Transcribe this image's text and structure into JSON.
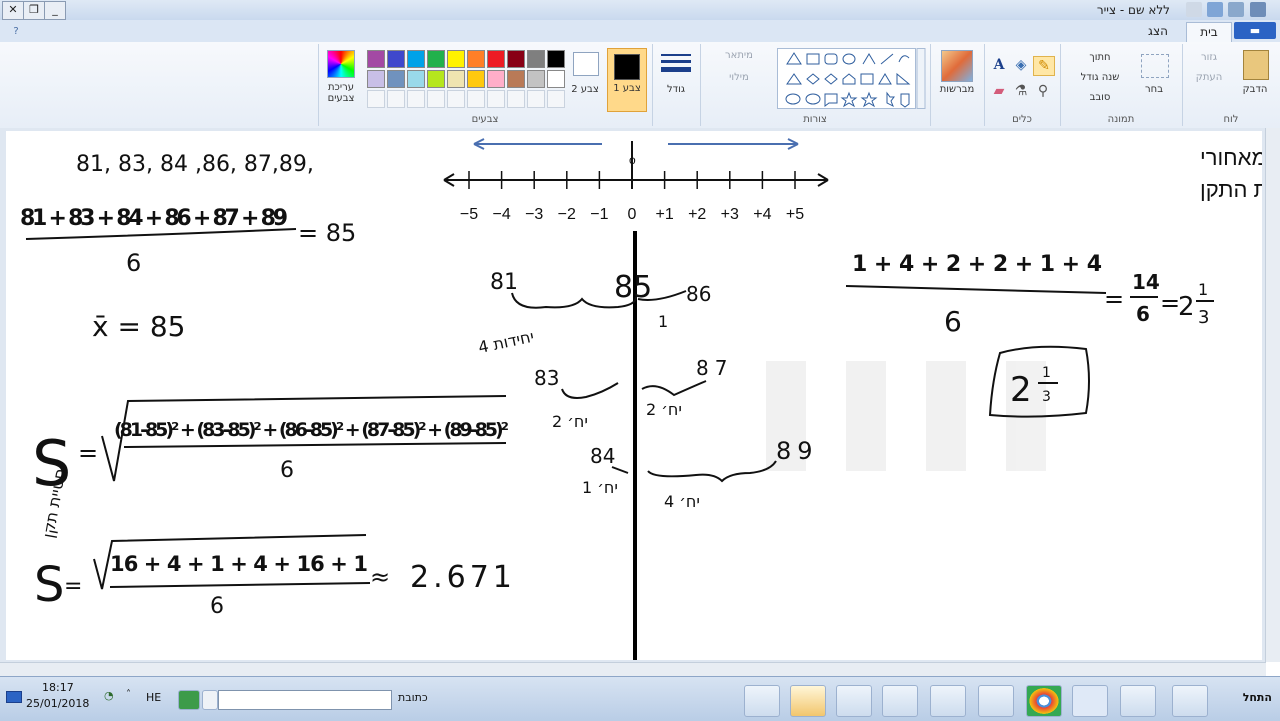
{
  "window": {
    "title": "ללא שם - צייר",
    "controls": [
      "✕",
      "❐",
      "_"
    ]
  },
  "tabs": {
    "file_label": "▬",
    "home": "בית",
    "view": "הצג"
  },
  "ribbon": {
    "clipboard": {
      "group": "לוח",
      "paste": "הדבק",
      "cut": "גזור",
      "copy": "העתק"
    },
    "image": {
      "group": "תמונה",
      "select": "בחר",
      "crop": "חתוך",
      "resize": "שנה גודל",
      "rotate": "סובב"
    },
    "tools": {
      "group": "כלים"
    },
    "brushes": {
      "label": "מברשות"
    },
    "shapes": {
      "group": "צורות",
      "outline": "מיתאר",
      "fill": "מילוי"
    },
    "size": {
      "label": "גודל"
    },
    "colors": {
      "group": "צבעים",
      "color1": "צבע 1",
      "color2": "צבע 2",
      "edit_colors": "עריכת צבעים",
      "palette_row1": [
        "#000000",
        "#7f7f7f",
        "#880015",
        "#ed1c24",
        "#ff7f27",
        "#fff200",
        "#22b14c",
        "#00a2e8",
        "#3f48cc",
        "#a349a4"
      ],
      "palette_row2": [
        "#ffffff",
        "#c3c3c3",
        "#b97a57",
        "#ffaec9",
        "#ffc90e",
        "#efe4b0",
        "#b5e61d",
        "#99d9ea",
        "#7092be",
        "#c8bfe7"
      ]
    }
  },
  "canvas": {
    "numbers_line": "81, 83,  84 ,86, 87,89,",
    "mean_fraction_numerator": "81 + 83 + 84 + 86 + 87 + 89",
    "mean_fraction_result": "= 85",
    "mean_denominator": "6",
    "mean_symbol": "x̄ = 85",
    "std_numerator": "(81-85)² + (83-85)² + (86-85)² + (87-85)² + (89-85)²",
    "std_denominator": "6",
    "std_label_s": "S",
    "std_label_word": "סטיית תקן",
    "std2_numerator": "16 + 4 + 1 + 4 + 16 + 1",
    "std2_denominator": "6",
    "std2_result": "2.671",
    "number_line_ticks": [
      "−5",
      "−4",
      "−3",
      "−2",
      "−1",
      "0",
      "+1",
      "+2",
      "+3",
      "+4",
      "+5"
    ],
    "number_line_zero_marker": "o",
    "explanation_line1": "הסבר לרעיון מאחורי",
    "explanation_line2": "סטיית התקן",
    "avg_dev_numerator": "1 + 4 + 2 + 2 + 1 + 4",
    "avg_dev_denominator": "6",
    "avg_dev_fraction_num": "14",
    "avg_dev_fraction_den": "6",
    "avg_dev_result": "2",
    "avg_dev_result_frac_num": "1",
    "avg_dev_result_frac_den": "3",
    "boxed_result": "2",
    "boxed_frac_num": "1",
    "boxed_frac_den": "3",
    "center_value": "85",
    "left_values": [
      "81",
      "83",
      "84"
    ],
    "right_values": [
      "86",
      "87",
      "89"
    ],
    "left_units": [
      "4 יחידות",
      "2 יח׳",
      "1 יח׳"
    ],
    "right_units": [
      "1",
      "2 יח׳",
      "4 יח׳"
    ]
  },
  "taskbar": {
    "start": "התחל",
    "address_label": "כתובת",
    "lang": "HE",
    "time": "18:17",
    "date": "25/01/2018"
  }
}
